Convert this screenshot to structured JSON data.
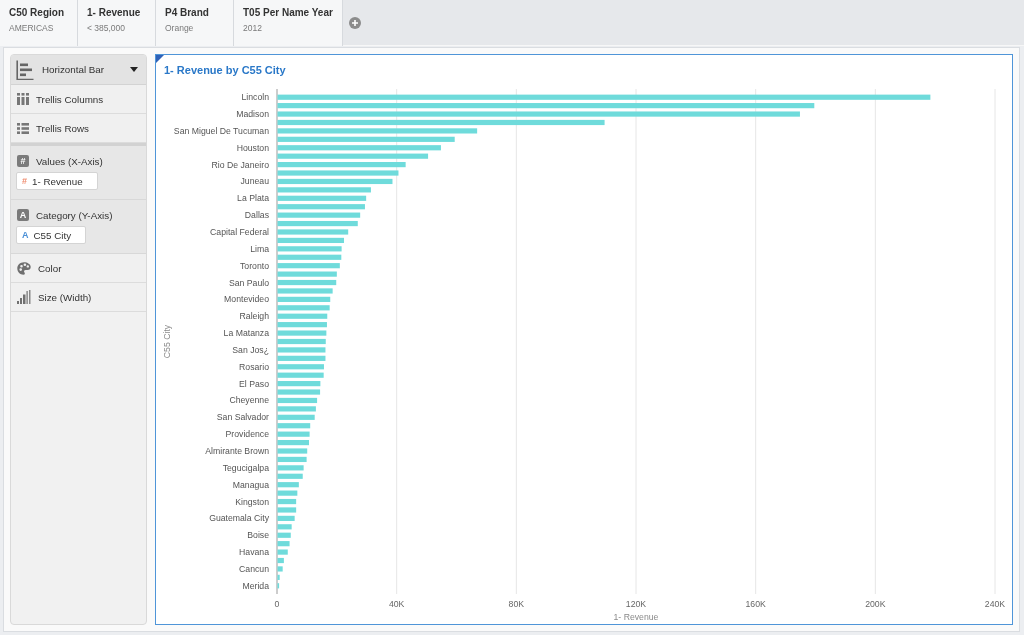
{
  "filters": [
    {
      "title": "C50 Region",
      "value": "AMERICAS"
    },
    {
      "title": "1- Revenue",
      "value": "< 385,000"
    },
    {
      "title": "P4 Brand",
      "value": "Orange"
    },
    {
      "title": "T05 Per Name Year",
      "value": "2012"
    }
  ],
  "builder": {
    "chart_type": "Horizontal Bar",
    "sections": [
      {
        "kind": "trellis_columns",
        "label": "Trellis Columns"
      },
      {
        "kind": "trellis_rows",
        "label": "Trellis Rows"
      },
      {
        "kind": "measure_zone",
        "label": "Values (X-Axis)",
        "glyph": "#",
        "items": [
          {
            "glyph": "#",
            "label": "1- Revenue"
          }
        ]
      },
      {
        "kind": "attribute_zone",
        "label": "Category (Y-Axis)",
        "glyph": "A",
        "items": [
          {
            "glyph": "A",
            "label": "C55 City"
          }
        ]
      },
      {
        "kind": "color",
        "label": "Color"
      },
      {
        "kind": "size",
        "label": "Size (Width)"
      }
    ]
  },
  "chart": {
    "title": "1- Revenue by C55 City",
    "chart_data": {
      "type": "bar",
      "orientation": "horizontal",
      "grid": true,
      "xlabel": "1- Revenue",
      "ylabel": "C55 City",
      "xlim": [
        0,
        240000
      ],
      "xticks": [
        {
          "value": 0,
          "label": "0"
        },
        {
          "value": 40000,
          "label": "40K"
        },
        {
          "value": 80000,
          "label": "80K"
        },
        {
          "value": 120000,
          "label": "120K"
        },
        {
          "value": 160000,
          "label": "160K"
        },
        {
          "value": 200000,
          "label": "200K"
        },
        {
          "value": 240000,
          "label": "240K"
        }
      ],
      "categories": [
        "Lincoln",
        null,
        "Madison",
        null,
        "San Miguel De Tucuman",
        null,
        "Houston",
        null,
        "Rio De Janeiro",
        null,
        "Juneau",
        null,
        "La Plata",
        null,
        "Dallas",
        null,
        "Capital Federal",
        null,
        "Lima",
        null,
        "Toronto",
        null,
        "San Paulo",
        null,
        "Montevideo",
        null,
        "Raleigh",
        null,
        "La Matanza",
        null,
        "San Jos¿",
        null,
        "Rosario",
        null,
        "El Paso",
        null,
        "Cheyenne",
        null,
        "San Salvador",
        null,
        "Providence",
        null,
        "Almirante Brown",
        null,
        "Tegucigalpa",
        null,
        "Managua",
        null,
        "Kingston",
        null,
        "Guatemala City",
        null,
        "Boise",
        null,
        "Havana",
        null,
        "Cancun",
        null,
        "Merida"
      ],
      "values": [
        218400,
        179600,
        174800,
        109500,
        66900,
        59400,
        54800,
        50500,
        43000,
        40600,
        38600,
        31400,
        29800,
        29400,
        27800,
        27000,
        23800,
        22400,
        21600,
        21500,
        21000,
        20000,
        19800,
        18600,
        17800,
        17600,
        16800,
        16700,
        16500,
        16300,
        16200,
        16200,
        15700,
        15600,
        14500,
        14400,
        13400,
        13000,
        12600,
        11100,
        10900,
        10700,
        10100,
        9900,
        8900,
        8600,
        7300,
        6800,
        6400,
        6400,
        5900,
        4900,
        4600,
        4200,
        3600,
        2300,
        1900,
        900,
        700
      ]
    }
  }
}
